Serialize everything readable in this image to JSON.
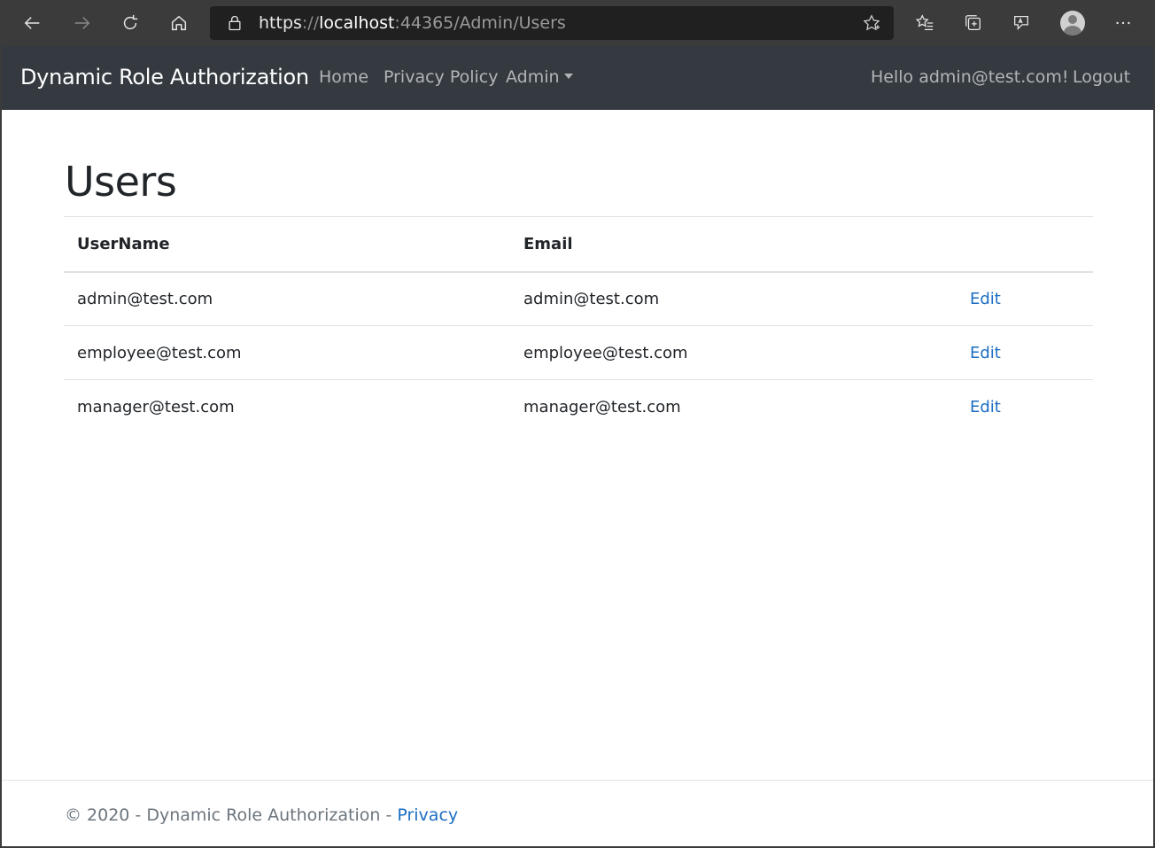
{
  "browser": {
    "url_scheme": "https",
    "url_separator": "://",
    "url_host": "localhost",
    "url_rest": ":44365/Admin/Users",
    "icons": [
      "back-icon",
      "forward-icon",
      "refresh-icon",
      "home-icon",
      "lock-icon",
      "star-icon",
      "favorites-icon",
      "collections-icon",
      "read-aloud-icon",
      "profile-icon",
      "more-icon"
    ]
  },
  "navbar": {
    "brand": "Dynamic Role Authorization",
    "links": [
      {
        "label": "Home"
      },
      {
        "label": "Privacy Policy"
      },
      {
        "label": "Admin"
      }
    ],
    "greeting": "Hello admin@test.com!",
    "logout": "Logout",
    "background": "#343a40"
  },
  "main": {
    "title": "Users",
    "table": {
      "headers": [
        "UserName",
        "Email",
        ""
      ],
      "rows": [
        {
          "username": "admin@test.com",
          "email": "admin@test.com",
          "action": "Edit"
        },
        {
          "username": "employee@test.com",
          "email": "employee@test.com",
          "action": "Edit"
        },
        {
          "username": "manager@test.com",
          "email": "manager@test.com",
          "action": "Edit"
        }
      ]
    },
    "link_color": "#1b6ec2"
  },
  "footer": {
    "text": "© 2020 - Dynamic Role Authorization - ",
    "link": "Privacy"
  }
}
